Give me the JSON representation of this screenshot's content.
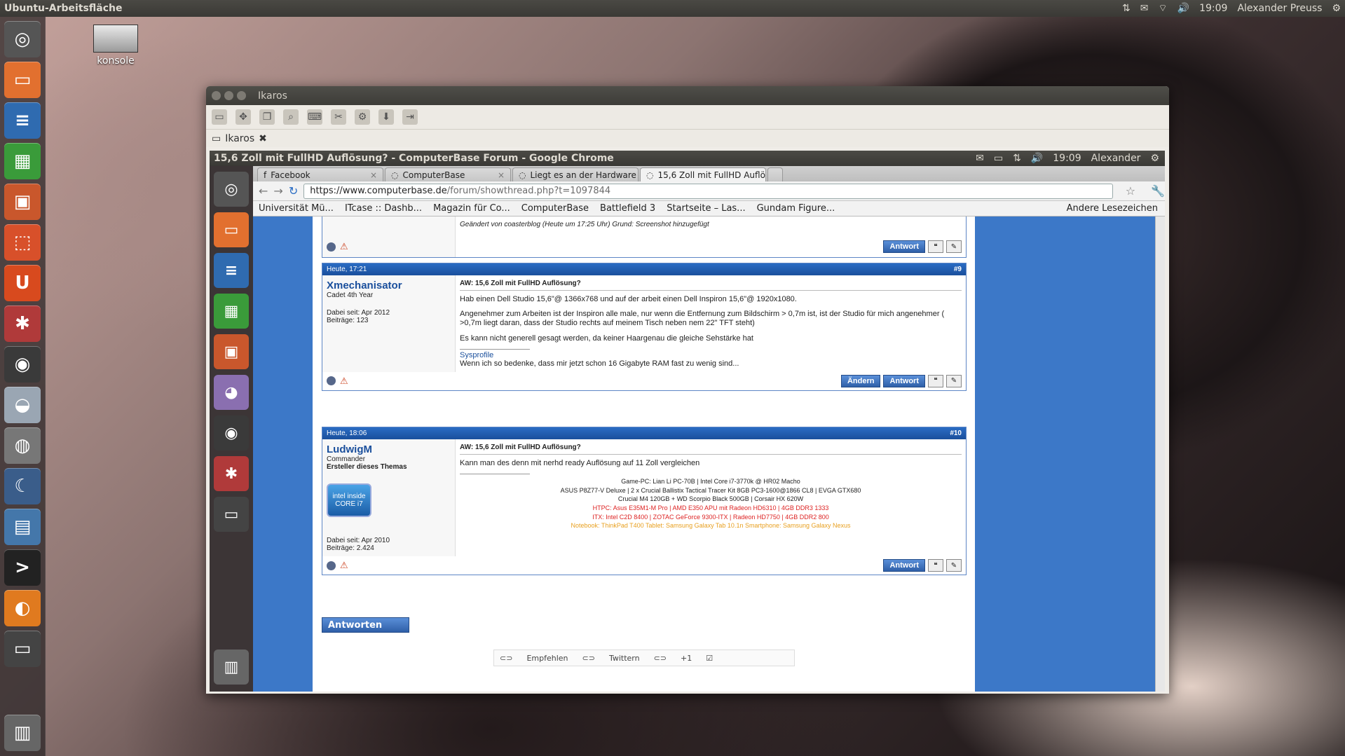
{
  "topbar": {
    "title": "Ubuntu-Arbeitsfläche",
    "time": "19:09",
    "user": "Alexander Preuss"
  },
  "desktop": {
    "icon_label": "konsole"
  },
  "window": {
    "title": "Ikaros",
    "tab_label": "Ikaros"
  },
  "chrome": {
    "title": "15,6 Zoll mit FullHD Auflösung? - ComputerBase Forum - Google Chrome",
    "time": "19:09",
    "user": "Alexander"
  },
  "tabs": [
    {
      "label": "Facebook"
    },
    {
      "label": "ComputerBase"
    },
    {
      "label": "Liegt es an der Hardware"
    },
    {
      "label": "15,6 Zoll mit FullHD Auflö"
    }
  ],
  "url": {
    "prefix": "https://www.computerbase.de",
    "path": "/forum/showthread.php?t=1097844"
  },
  "bookmarks": [
    "Universität Mü...",
    "ITcase :: Dashb...",
    "Magazin für Co...",
    "ComputerBase",
    "Battlefield 3",
    "Startseite – Las...",
    "Gundam Figure..."
  ],
  "bookmarks_other": "Andere Lesezeichen",
  "post_prev": {
    "edit_note": "Geändert von coasterblog (Heute um 17:25 Uhr) Grund: Screenshot hinzugefügt",
    "reply": "Antwort"
  },
  "post9": {
    "date": "Heute, 17:21",
    "num": "#9",
    "user": "Xmechanisator",
    "rank": "Cadet 4th Year",
    "since": "Dabei seit: Apr 2012",
    "posts": "Beiträge: 123",
    "subject": "AW: 15,6 Zoll mit FullHD Auflösung?",
    "p1": "Hab einen Dell Studio 15,6\"@ 1366x768 und auf der arbeit einen Dell Inspiron 15,6\"@ 1920x1080.",
    "p2": "Angenehmer zum Arbeiten ist der Inspiron alle male, nur wenn die Entfernung zum Bildschirm > 0,7m ist, ist der Studio für mich angenehmer ( >0,7m liegt daran, dass der Studio rechts auf meinem Tisch neben nem 22\" TFT steht)",
    "p3": "Es kann nicht generell gesagt werden, da keiner Haargenau die gleiche Sehstärke hat",
    "sig_link": "Sysprofile",
    "sig": "Wenn ich so bedenke, dass mir jetzt schon 16 Gigabyte RAM fast zu wenig sind...",
    "edit": "Ändern",
    "reply": "Antwort"
  },
  "post10": {
    "date": "Heute, 18:06",
    "num": "#10",
    "user": "LudwigM",
    "rank": "Commander",
    "starter": "Ersteller dieses Themas",
    "since": "Dabei seit: Apr 2010",
    "posts": "Beiträge: 2.424",
    "subject": "AW: 15,6 Zoll mit FullHD Auflösung?",
    "p1": "Kann man des denn mit nerhd ready Auflösung auf 11 Zoll vergleichen",
    "s1": "Game-PC: Lian Li PC-70B | Intel Core i7-3770k @ HR02 Macho",
    "s2": "ASUS P8Z77-V Deluxe | 2 x Crucial Ballistix Tactical Tracer Kit 8GB PC3-1600@1866 CL8 | EVGA GTX680",
    "s3": "Crucial M4 120GB + WD Scorpio Black 500GB | Corsair HX 620W",
    "s4": "HTPC: Asus E35M1-M Pro | AMD E350 APU mit Radeon HD6310 | 4GB DDR3 1333",
    "s5": "ITX: Intel C2D 8400 | ZOTAC GeForce 9300-ITX | Radeon HD7750 | 4GB DDR2 800",
    "s6": "Notebook: ThinkPad T400 Tablet: Samsung Galaxy Tab 10.1n Smartphone: Samsung Galaxy Nexus",
    "intel1": "intel inside",
    "intel2": "CORE i7",
    "reply": "Antwort"
  },
  "answer_button": "Antworten",
  "share": {
    "fb": "Empfehlen",
    "tw": "Twittern",
    "gp": "+1"
  }
}
